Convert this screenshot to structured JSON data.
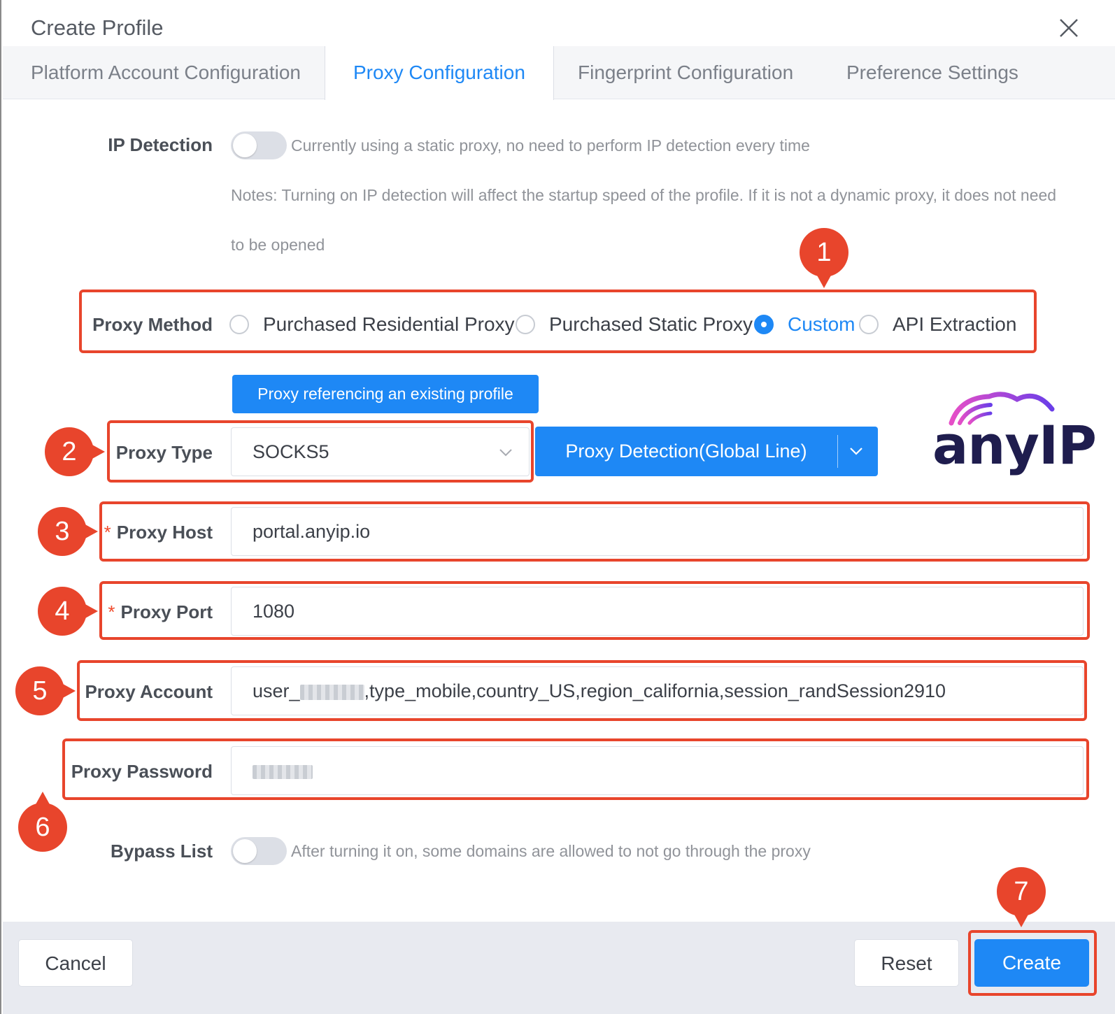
{
  "dialog": {
    "title": "Create Profile"
  },
  "tabs": [
    {
      "label": "Platform Account Configuration",
      "active": false
    },
    {
      "label": "Proxy Configuration",
      "active": true
    },
    {
      "label": "Fingerprint Configuration",
      "active": false
    },
    {
      "label": "Preference Settings",
      "active": false
    }
  ],
  "ip_detection": {
    "label": "IP Detection",
    "enabled": false,
    "hint": "Currently using a static proxy, no need to perform IP detection every time",
    "note_line1": "Notes: Turning on IP detection will affect the startup speed of the profile. If it is not a dynamic proxy, it does not need",
    "note_line2": "to be opened"
  },
  "proxy_method": {
    "label": "Proxy Method",
    "options": [
      {
        "label": "Purchased Residential Proxy",
        "checked": false
      },
      {
        "label": "Purchased Static Proxy",
        "checked": false
      },
      {
        "label": "Custom",
        "checked": true
      },
      {
        "label": "API Extraction",
        "checked": false
      }
    ]
  },
  "reference_button": "Proxy referencing an existing profile",
  "proxy_type": {
    "label": "Proxy Type",
    "value": "SOCKS5"
  },
  "detection_button": "Proxy Detection(Global Line)",
  "proxy_host": {
    "required_mark": "*",
    "label": "Proxy Host",
    "value": "portal.anyip.io"
  },
  "proxy_port": {
    "required_mark": "*",
    "label": "Proxy Port",
    "value": "1080"
  },
  "proxy_account": {
    "label": "Proxy Account",
    "prefix": "user_",
    "suffix": ",type_mobile,country_US,region_california,session_randSession2910"
  },
  "proxy_password": {
    "label": "Proxy Password"
  },
  "bypass_list": {
    "label": "Bypass List",
    "enabled": false,
    "hint": "After turning it on, some domains are allowed to not go through the proxy"
  },
  "logo": {
    "text": "anyIP"
  },
  "annotations": [
    "1",
    "2",
    "3",
    "4",
    "5",
    "6",
    "7"
  ],
  "footer": {
    "cancel": "Cancel",
    "reset": "Reset",
    "create": "Create"
  },
  "colors": {
    "primary": "#1e88f5",
    "annotation": "#e8452c"
  }
}
